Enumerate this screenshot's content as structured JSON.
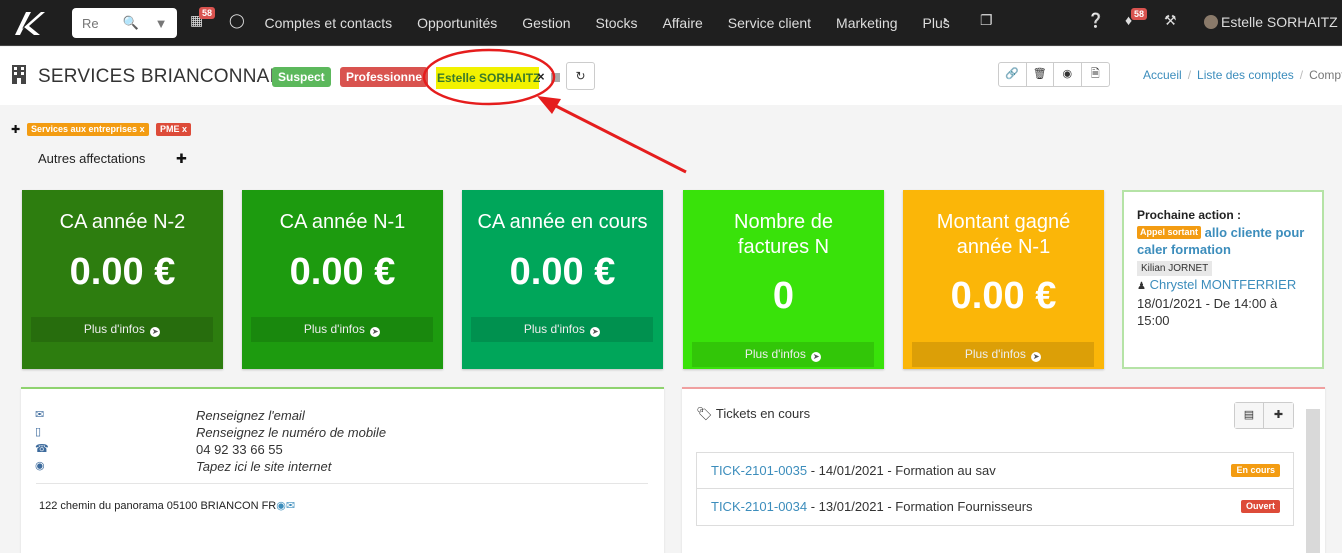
{
  "navbar": {
    "search_placeholder": "Re",
    "agenda_badge": "58",
    "menu": [
      "Comptes et contacts",
      "Opportunités",
      "Gestion",
      "Stocks",
      "Affaire",
      "Service client",
      "Marketing",
      "Plus"
    ],
    "notif_badge": "58",
    "user_name": "Estelle SORHAITZ"
  },
  "header": {
    "title": "SERVICES BRIANCONNAIS",
    "label_suspect": "Suspect",
    "label_professionnel": "Professionne",
    "assigned_user": "Estelle SORHAITZ",
    "remove_mark": "×",
    "breadcrumb": {
      "home": "Accueil",
      "list": "Liste des comptes",
      "current": "Compte"
    }
  },
  "tags": {
    "items": [
      {
        "label": "Services aux entreprises x",
        "color": "#f39c12"
      },
      {
        "label": "PME x",
        "color": "#dd4b39"
      }
    ],
    "other_assignments": "Autres affectations"
  },
  "kpis": [
    {
      "title": "CA année N-2",
      "value": "0.00 €",
      "more": "Plus d'infos",
      "color": "#2d7d0f"
    },
    {
      "title": "CA année N-1",
      "value": "0.00 €",
      "more": "Plus d'infos",
      "color": "#1d9b0f"
    },
    {
      "title": "CA année en cours",
      "value": "0.00 €",
      "more": "Plus d'infos",
      "color": "#00a65a"
    },
    {
      "title": "Nombre de factures N",
      "value": "0",
      "more": "Plus d'infos",
      "color": "#39e20a"
    },
    {
      "title": "Montant gagné année N-1",
      "value": "0.00 €",
      "more": "Plus d'infos",
      "color": "#fbb608"
    }
  ],
  "next_action": {
    "title": "Prochaine action :",
    "type_badge": "Appel sortant",
    "subject": "allo cliente pour caler formation",
    "assigned_user": "Kilian JORNET",
    "contact": "Chrystel MONTFERRIER",
    "schedule": "18/01/2021 - De 14:00 à 15:00"
  },
  "contact_info": {
    "email": "Renseignez l'email",
    "mobile": "Renseignez le numéro de mobile",
    "phone": "04 92 33 66 55",
    "website": "Tapez ici le site internet",
    "address": "122 chemin du panorama 05100 BRIANCON FR"
  },
  "tickets": {
    "title": "Tickets en cours",
    "items": [
      {
        "id": "TICK-2101-0035",
        "rest": " - 14/01/2021 - Formation au sav",
        "status": "En cours",
        "status_color": "#f39c12"
      },
      {
        "id": "TICK-2101-0034",
        "rest": " - 13/01/2021 - Formation Fournisseurs",
        "status": "Ouvert",
        "status_color": "#dd4b39"
      }
    ]
  }
}
